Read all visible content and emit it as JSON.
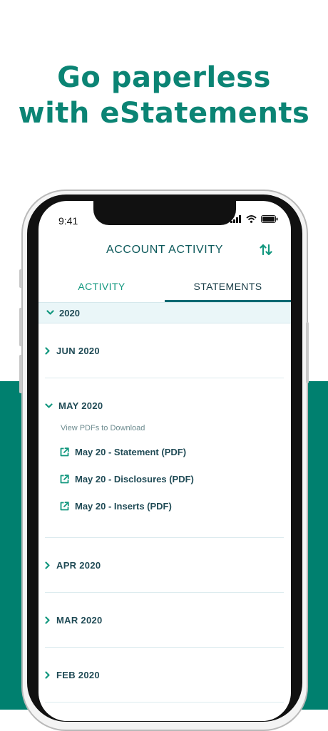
{
  "headline": {
    "line1": "Go paperless",
    "line2": "with eStatements"
  },
  "status_bar": {
    "time": "9:41"
  },
  "screen": {
    "title": "ACCOUNT ACTIVITY",
    "tabs": [
      {
        "label": "ACTIVITY",
        "selected": false
      },
      {
        "label": "STATEMENTS",
        "selected": true
      }
    ],
    "year": "2020",
    "months": [
      {
        "label": "JUN 2020",
        "expanded": false
      },
      {
        "label": "MAY 2020",
        "expanded": true
      },
      {
        "label": "APR 2020",
        "expanded": false
      },
      {
        "label": "MAR 2020",
        "expanded": false
      },
      {
        "label": "FEB 2020",
        "expanded": false
      }
    ],
    "pdf_hint": "View PDFs to Download",
    "pdf_links": [
      {
        "label": "May 20 - Statement (PDF)",
        "icon": "external-link-icon"
      },
      {
        "label": "May 20 - Disclosures (PDF)",
        "icon": "external-link-icon"
      },
      {
        "label": "May 20 - Inserts (PDF)",
        "icon": "external-link-icon"
      }
    ]
  },
  "colors": {
    "brand_teal": "#0b8474",
    "band_teal": "#00806f",
    "text_dark": "#1f4a55",
    "accent": "#13987f"
  }
}
